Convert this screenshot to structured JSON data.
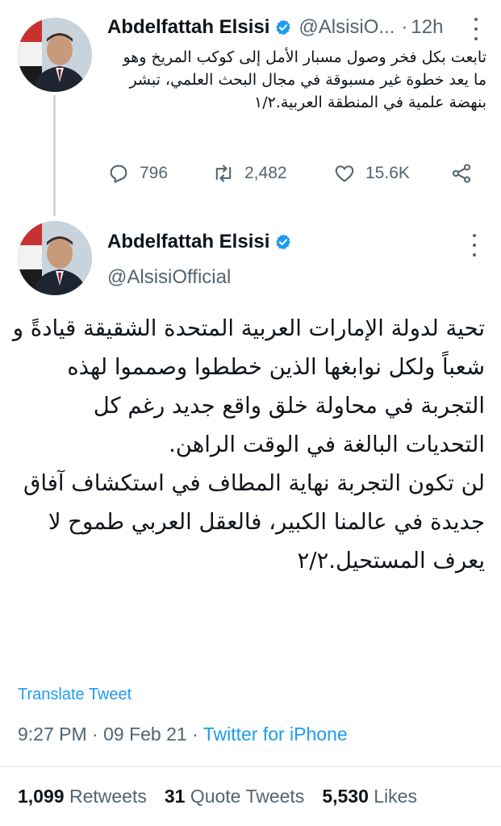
{
  "colors": {
    "accent": "#1d9bf0",
    "secondary_text": "#536471",
    "primary_text": "#0f1419",
    "thread_line": "#cfd9de"
  },
  "reply_tweet": {
    "author_name": "Abdelfattah Elsisi",
    "handle": "@AlsisiO...",
    "time": "12h",
    "text": "تابعت بكل فخر وصول مسبار الأمل إلى كوكب المريخ وهو ما يعد خطوة غير مسبوقة في مجال البحث العلمي، تبشر بنهضة علمية في المنطقة العربية.١/٢",
    "replies": "796",
    "retweets": "2,482",
    "likes": "15.6K",
    "icons": [
      "reply-icon",
      "retweet-icon",
      "like-icon",
      "share-icon"
    ]
  },
  "main_tweet": {
    "author_name": "Abdelfattah Elsisi",
    "handle": "@AlsisiOfficial",
    "text_paragraph1": "تحية لدولة الإمارات العربية المتحدة الشقيقة قيادةً و شعباً ولكل نوابغها الذين خططوا وصمموا لهذه التجربة في محاولة خلق واقع جديد رغم كل التحديات البالغة في الوقت الراهن.",
    "text_paragraph2": "لن تكون التجربة نهاية المطاف في استكشاف آفاق جديدة في عالمنا الكبير، فالعقل العربي طموح لا يعرف المستحيل.٢/٢",
    "translate_label": "Translate Tweet",
    "timestamp": "9:27 PM · 09 Feb 21 · ",
    "source": "Twitter for iPhone",
    "stats": {
      "retweets_count": "1,099",
      "retweets_label": "Retweets",
      "quotes_count": "31",
      "quotes_label": "Quote Tweets",
      "likes_count": "5,530",
      "likes_label": "Likes"
    }
  }
}
